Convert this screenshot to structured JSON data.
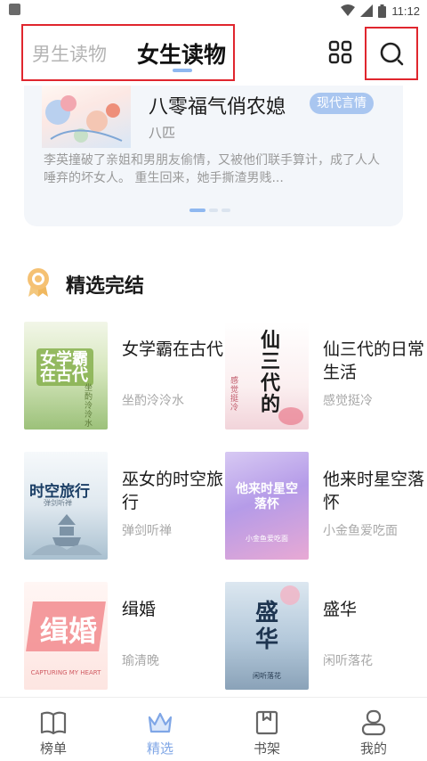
{
  "status_bar": {
    "time": "11:12"
  },
  "header": {
    "tabs": [
      {
        "label": "男生读物",
        "active": false
      },
      {
        "label": "女生读物",
        "active": true
      }
    ]
  },
  "featured": {
    "title": "八零福气俏农媳",
    "tag": "现代言情",
    "author": "八匹",
    "description": "李英撞破了亲姐和男朋友偷情，又被他们联手算计，成了人人唾弃的坏女人。 重生回来，她手撕渣男贱...",
    "carousel_total": 3,
    "carousel_active": 1
  },
  "section": {
    "title": "精选完结"
  },
  "books": [
    {
      "title": "女学霸在古代",
      "author": "坐酌泠泠水",
      "cover_text": "女学霸在古代",
      "cover_small": "坐酌泠泠水"
    },
    {
      "title": "仙三代的日常生活",
      "author": "感觉挺冷",
      "cover_text": "仙三代的",
      "cover_small": "感觉挺冷"
    },
    {
      "title": "巫女的时空旅行",
      "author": "弹剑听禅",
      "cover_text": "时空旅行",
      "cover_small": "弹剑听禅"
    },
    {
      "title": "他来时星空落怀",
      "author": "小金鱼爱吃面",
      "cover_text": "他来时星空落怀",
      "cover_small": "小金鱼爱吃面"
    },
    {
      "title": "缉婚",
      "author": "瑜清晚",
      "cover_text": "缉婚",
      "cover_small": "CAPTURING MY HEART"
    },
    {
      "title": "盛华",
      "author": "闲听落花",
      "cover_text": "盛华",
      "cover_small": "闲听落花"
    }
  ],
  "bottom_nav": [
    {
      "label": "榜单",
      "icon": "book-icon",
      "active": false
    },
    {
      "label": "精选",
      "icon": "crown-icon",
      "active": true
    },
    {
      "label": "书架",
      "icon": "bookshelf-icon",
      "active": false
    },
    {
      "label": "我的",
      "icon": "user-icon",
      "active": false
    }
  ],
  "colors": {
    "accent": "#8fb8f0",
    "highlight_box": "#e0262e",
    "card_bg": "#f3f6fa"
  }
}
